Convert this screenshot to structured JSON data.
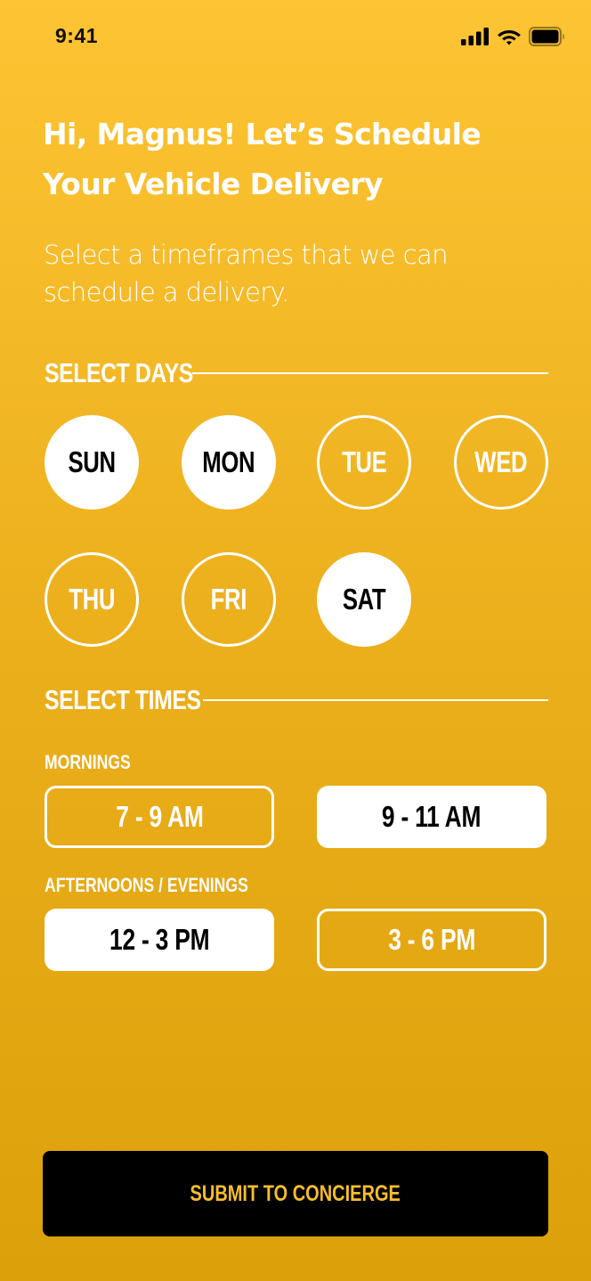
{
  "status_bar": {
    "time": "9:41",
    "icons": [
      "cellular-signal-icon",
      "wifi-icon",
      "battery-icon"
    ]
  },
  "header": {
    "title": "Hi, Magnus! Let’s Schedule Your Vehicle Delivery",
    "subtitle": "Select a timeframes that we can schedule a delivery."
  },
  "days_section": {
    "heading": "SELECT DAYS",
    "days": [
      {
        "label": "SUN",
        "selected": true
      },
      {
        "label": "MON",
        "selected": true
      },
      {
        "label": "TUE",
        "selected": false
      },
      {
        "label": "WED",
        "selected": false
      },
      {
        "label": "THU",
        "selected": false
      },
      {
        "label": "FRI",
        "selected": false
      },
      {
        "label": "SAT",
        "selected": true
      }
    ]
  },
  "times_section": {
    "heading": "SELECT TIMES",
    "mornings": {
      "label": "MORNINGS",
      "slots": [
        {
          "label": "7 - 9 AM",
          "selected": false
        },
        {
          "label": "9 - 11 AM",
          "selected": true
        }
      ]
    },
    "afternoons": {
      "label": "AFTERNOONS / EVENINGS",
      "slots": [
        {
          "label": "12 - 3 PM",
          "selected": true
        },
        {
          "label": "3 - 6 PM",
          "selected": false
        }
      ]
    }
  },
  "submit": {
    "label": "SUBMIT TO CONCIERGE"
  },
  "colors": {
    "background_top": "#FDC433",
    "background_bottom": "#DCA00A",
    "selected_fill": "#FFFFFF",
    "button_fill": "#000000",
    "button_text": "#F7BE2B"
  }
}
